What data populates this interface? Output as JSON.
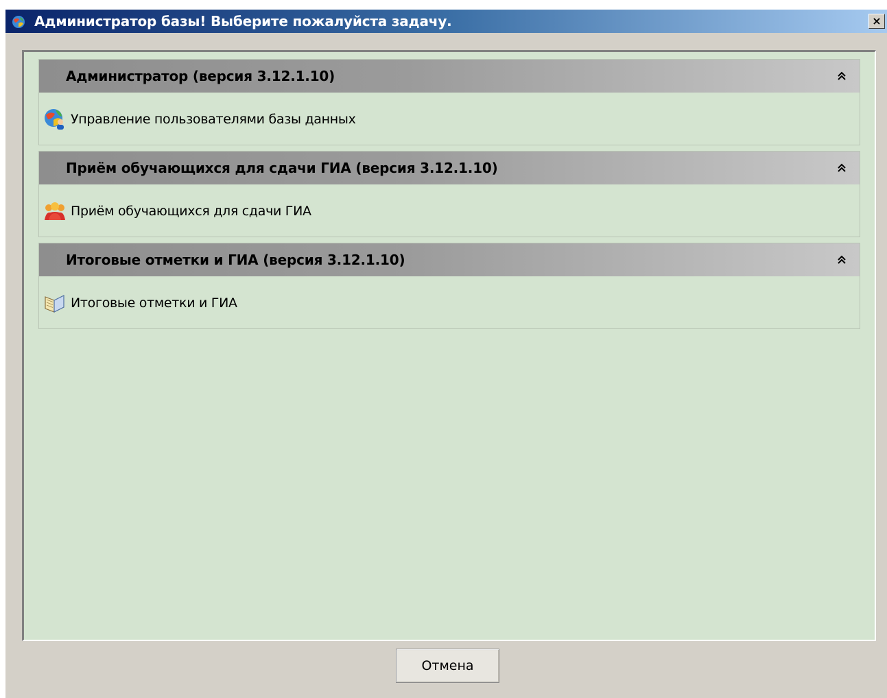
{
  "window": {
    "title": "Администратор базы! Выберите пожалуйста задачу.",
    "close_label": "×"
  },
  "groups": [
    {
      "title": "Администратор (версия 3.12.1.10)",
      "items": [
        {
          "label": "Управление пользователями базы данных",
          "icon": "users-globe-icon"
        }
      ]
    },
    {
      "title": "Приём обучающихся для сдачи ГИА (версия 3.12.1.10)",
      "items": [
        {
          "label": "Приём обучающихся для сдачи ГИА",
          "icon": "students-group-icon"
        }
      ]
    },
    {
      "title": "Итоговые отметки и ГИА (версия 3.12.1.10)",
      "items": [
        {
          "label": "Итоговые отметки и ГИА",
          "icon": "open-book-icon"
        }
      ]
    }
  ],
  "footer": {
    "cancel_label": "Отмена"
  },
  "colors": {
    "content_bg": "#d4e4d0",
    "header_gradient_start": "#8e8e8e",
    "header_gradient_end": "#c8c8c8",
    "titlebar_start": "#0a246a",
    "titlebar_end": "#a6caf0"
  }
}
